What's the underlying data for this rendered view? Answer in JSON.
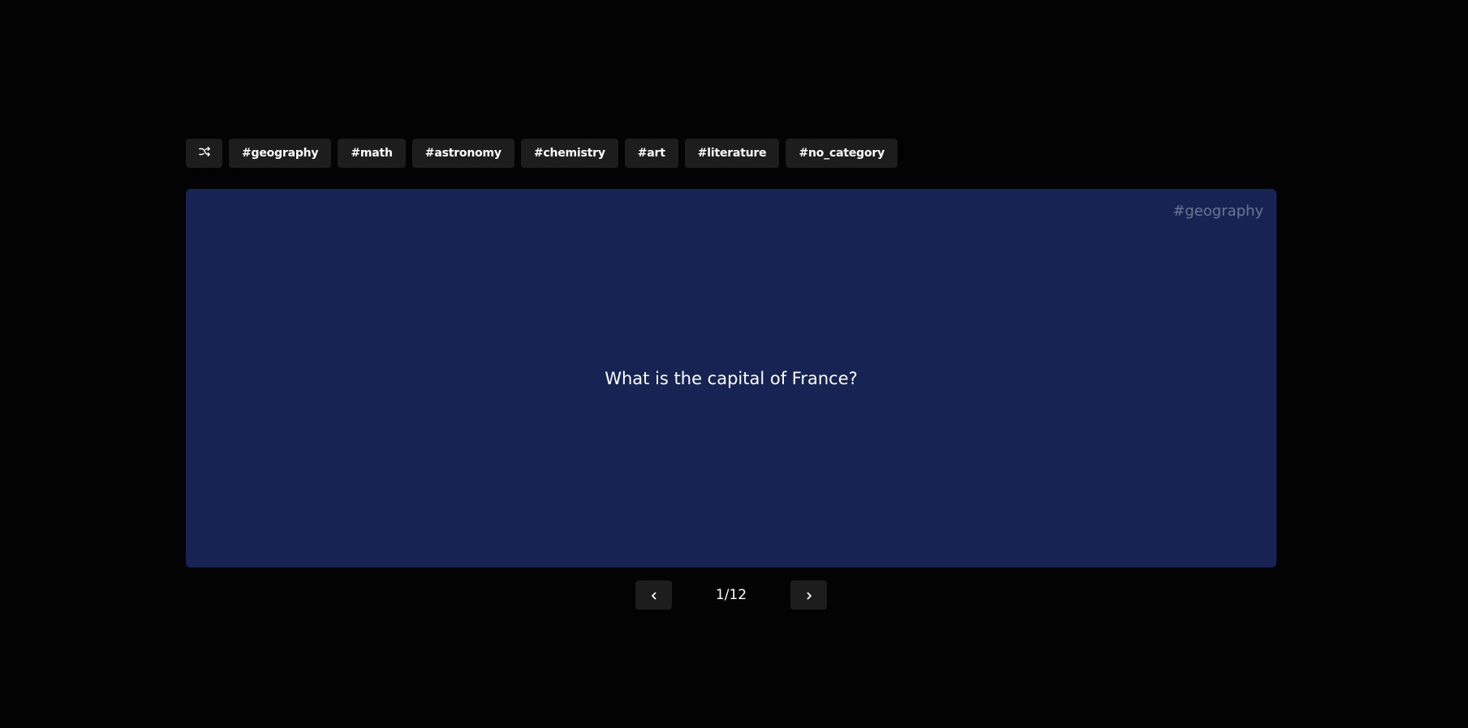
{
  "toolbar": {
    "shuffle_icon": "shuffle-icon",
    "tags": [
      "#geography",
      "#math",
      "#astronomy",
      "#chemistry",
      "#art",
      "#literature",
      "#no_category"
    ]
  },
  "card": {
    "category": "#geography",
    "question": "What is the capital of France?",
    "background_color": "#172453"
  },
  "pager": {
    "prev_icon": "chevron-left-icon",
    "next_icon": "chevron-right-icon",
    "counter": "1/12"
  }
}
